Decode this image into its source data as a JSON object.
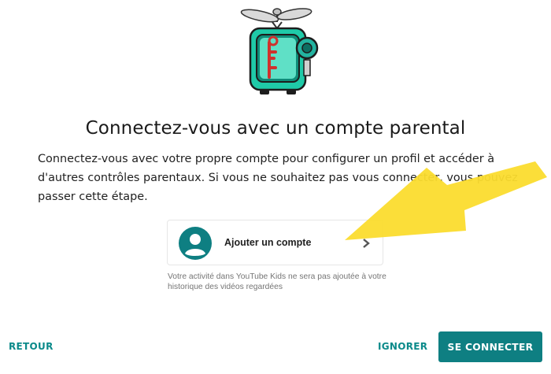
{
  "dialog": {
    "title": "Connectez-vous avec un compte parental",
    "description": "Connectez-vous avec votre propre compte pour configurer un profil et accéder à d'autres contrôles parentaux. Si vous ne souhaitez pas vous connecter, vous pouvez passer cette étape."
  },
  "account_card": {
    "label": "Ajouter un compte",
    "avatar_icon": "account-circle-icon",
    "chevron_icon": "chevron-right-icon"
  },
  "note": "Votre activité dans YouTube Kids ne sera pas ajoutée à votre historique des vidéos regardées",
  "footer": {
    "back_label": "RETOUR",
    "skip_label": "IGNORER",
    "connect_label": "SE CONNECTER"
  },
  "colors": {
    "accent": "#0e7f82",
    "link": "#0b8a8a",
    "annotation_arrow": "#fbdc2e"
  }
}
